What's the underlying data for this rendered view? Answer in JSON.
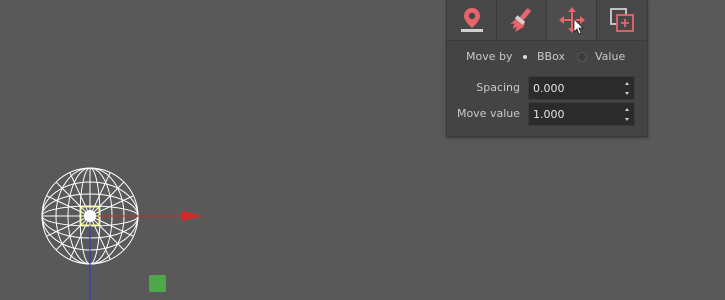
{
  "toolbar": {
    "tools": [
      {
        "icon": "map-pin-icon",
        "active": false
      },
      {
        "icon": "paint-brush-icon",
        "active": false
      },
      {
        "icon": "move-arrows-icon",
        "active": true
      },
      {
        "icon": "add-layer-icon",
        "active": false
      }
    ],
    "accent_color": "#e8646b"
  },
  "move_by": {
    "label": "Move by",
    "options": [
      {
        "label": "BBox",
        "selected": true
      },
      {
        "label": "Value",
        "selected": false
      }
    ]
  },
  "spacing": {
    "label": "Spacing",
    "value": "0.000"
  },
  "move_value": {
    "label": "Move value",
    "value": "1.000"
  },
  "scene": {
    "background_color": "#595959",
    "x_axis_color": "#d22a2a",
    "y_axis_color": "#2a34d2",
    "object_color": "#ffffff",
    "pivot_color": "#ffff66",
    "marker_color": "#4ea84a"
  }
}
